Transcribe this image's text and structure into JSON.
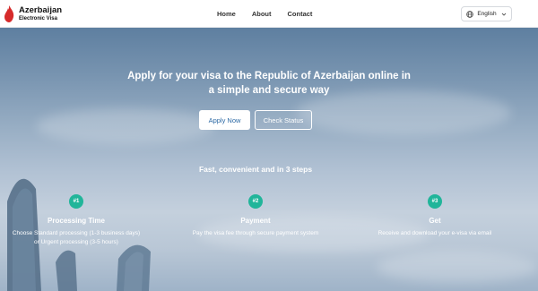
{
  "header": {
    "logo_icon": "flame-icon",
    "brand_title": "Azerbaijan",
    "brand_subtitle": "Electronic Visa",
    "nav": [
      "Home",
      "About",
      "Contact"
    ],
    "language": {
      "icon": "globe-icon",
      "label": "English",
      "chevron": "chevron-down-icon"
    }
  },
  "hero": {
    "title_line1": "Apply for your visa to the Republic of Azerbaijan online in",
    "title_line2": "a simple and secure way",
    "apply_label": "Apply Now",
    "status_label": "Check Status"
  },
  "steps": {
    "heading": "Fast, convenient and in 3 steps",
    "items": [
      {
        "badge": "#1",
        "title": "Processing Time",
        "desc_line1": "Choose Standard processing (1-3 business days)",
        "desc_line2": "or Urgent processing (3-5 hours)"
      },
      {
        "badge": "#2",
        "title": "Payment",
        "desc_line1": "Pay the visa fee through secure payment system",
        "desc_line2": ""
      },
      {
        "badge": "#3",
        "title": "Get",
        "desc_line1": "Receive and download your e-visa via email",
        "desc_line2": ""
      }
    ]
  },
  "colors": {
    "accent": "#21b59a",
    "primary_text": "#2d6aa5",
    "logo_red": "#d62b2b"
  }
}
